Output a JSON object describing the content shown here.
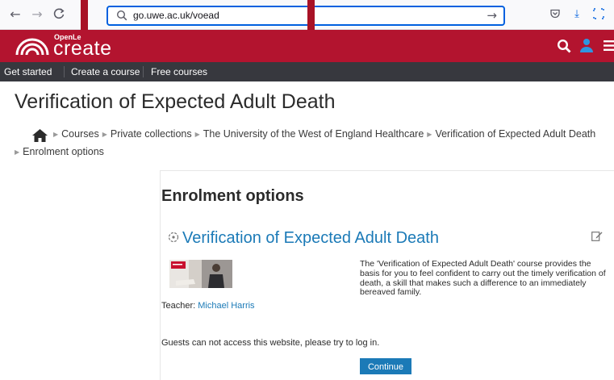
{
  "browser": {
    "url": "go.uwe.ac.uk/voead",
    "back_icon": "←",
    "forward_icon": "→",
    "reload_icon": "C",
    "go_icon": "→",
    "pocket_icon": "pocket-icon",
    "download_icon": "⤓",
    "screenshot_icon": "screenshot-icon"
  },
  "header": {
    "brand_small": "OpenLe",
    "brand_big": "create",
    "brand_color": "#b3142f"
  },
  "nav": {
    "items": [
      "Get started",
      "Create a course",
      "Free courses"
    ]
  },
  "page": {
    "title": "Verification of Expected Adult Death"
  },
  "breadcrumb": {
    "items": [
      "Courses",
      "Private collections",
      "The University of the West of England Healthcare",
      "Verification of Expected Adult Death",
      "Enrolment options"
    ]
  },
  "main": {
    "heading": "Enrolment options",
    "course_title": "Verification of Expected Adult Death",
    "teacher_label": "Teacher:",
    "teacher_name": "Michael Harris",
    "summary": "The 'Verification of Expected Adult Death' course provides the basis for you to feel confident to carry out the timely verification of death, a skill that makes such a difference to an immediately bereaved family.",
    "guest_message": "Guests can not access this website, please try to log in.",
    "continue_label": "Continue"
  },
  "colors": {
    "link": "#1b7ab7",
    "nav_bg": "#37383e",
    "annotation": "#a81226"
  }
}
